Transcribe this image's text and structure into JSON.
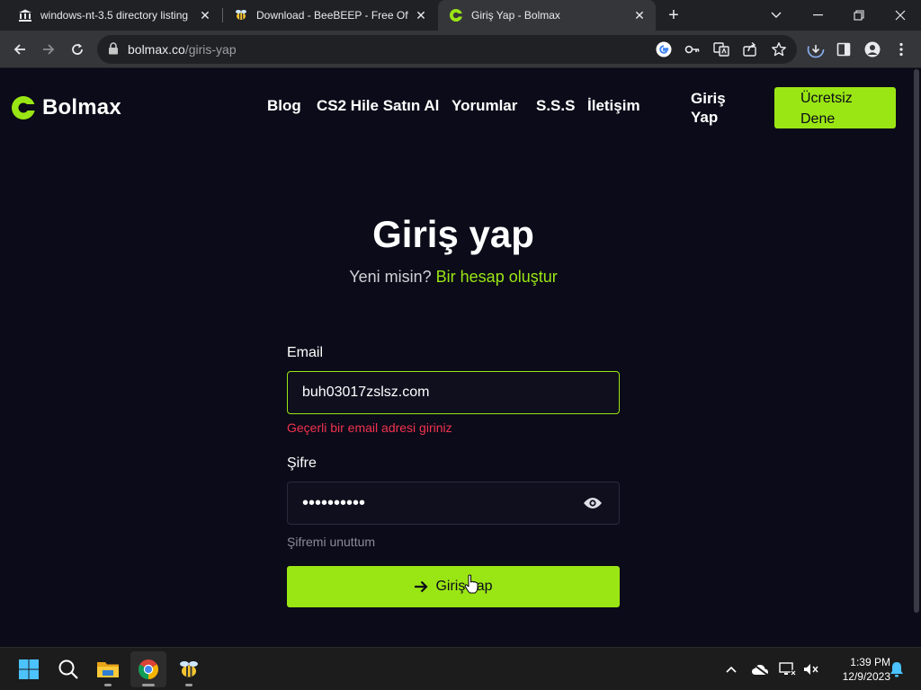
{
  "browser": {
    "tabs": [
      {
        "title": "windows-nt-3.5 directory listing",
        "favicon": "archive-icon",
        "active": false
      },
      {
        "title": "Download - BeeBEEP - Free Offic",
        "favicon": "bee-icon",
        "active": false
      },
      {
        "title": "Giriş Yap - Bolmax",
        "favicon": "bolmax-icon",
        "active": true
      }
    ],
    "url_host": "bolmax.co",
    "url_path": "/giris-yap"
  },
  "site": {
    "brand": "Bolmax",
    "brand_color": "#9ae614",
    "nav": [
      "Blog",
      "CS2 Hile Satın Al",
      "Yorumlar",
      "S.S.S",
      "İletişim"
    ],
    "login_line1": "Giriş",
    "login_line2": "Yap",
    "cta_line1": "Ücretsiz",
    "cta_line2": "Dene"
  },
  "form": {
    "heading": "Giriş yap",
    "subtitle_prefix": "Yeni misin?",
    "subtitle_link": "Bir hesap oluştur",
    "email_label": "Email",
    "email_value": "buh03017zslsz.com",
    "email_error": "Geçerli bir email adresi giriniz",
    "error_color": "#f2334f",
    "password_label": "Şifre",
    "password_value": "••••••••••",
    "forgot": "Şifremi unuttum",
    "submit": "Giriş yap"
  },
  "taskbar": {
    "apps": [
      "windows-start-icon",
      "search-icon",
      "file-explorer-icon",
      "chrome-icon",
      "beebeep-icon"
    ],
    "time": "1:39 PM",
    "date": "12/9/2023"
  }
}
